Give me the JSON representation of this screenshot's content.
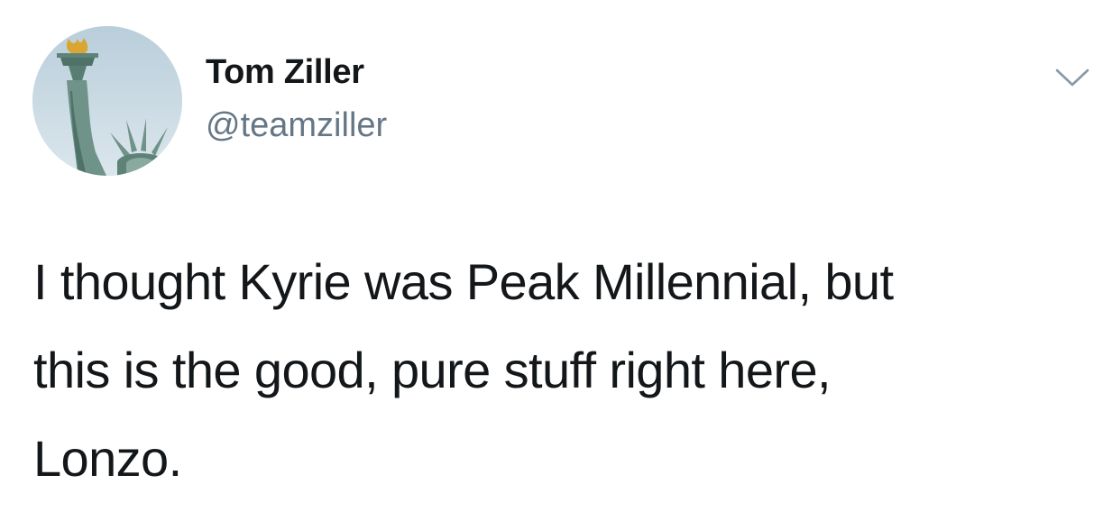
{
  "tweet": {
    "author": {
      "display_name": "Tom Ziller",
      "handle": "@teamziller",
      "avatar_icon": "statue-of-liberty-avatar"
    },
    "menu_icon": "chevron-down-icon",
    "text": "I thought Kyrie was Peak Millennial, but\nthis is the good, pure stuff right here,\nLonzo."
  },
  "colors": {
    "background": "#ffffff",
    "name_text": "#14171a",
    "handle_text": "#657786",
    "chevron": "#8899a6",
    "avatar_sky": "#c9d8e3",
    "statue_green": "#6f9388",
    "torch_flame": "#d8a631"
  }
}
